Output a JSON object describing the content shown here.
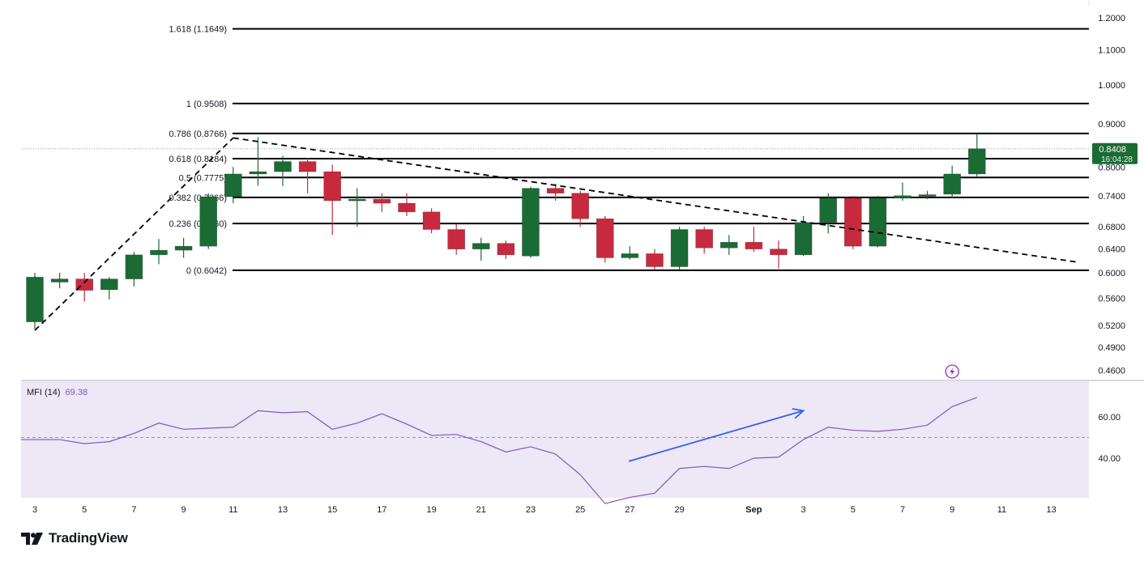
{
  "chart_data": {
    "type": "candlestick",
    "platform": "TradingView",
    "dates": [
      "Aug 3",
      "Aug 4",
      "Aug 5",
      "Aug 6",
      "Aug 7",
      "Aug 8",
      "Aug 9",
      "Aug 10",
      "Aug 11",
      "Aug 12",
      "Aug 13",
      "Aug 14",
      "Aug 15",
      "Aug 16",
      "Aug 17",
      "Aug 18",
      "Aug 19",
      "Aug 20",
      "Aug 21",
      "Aug 22",
      "Aug 23",
      "Aug 24",
      "Aug 25",
      "Aug 26",
      "Aug 27",
      "Aug 28",
      "Aug 29",
      "Aug 30",
      "Aug 31",
      "Sep 1",
      "Sep 2",
      "Sep 3",
      "Sep 4",
      "Sep 5",
      "Sep 6",
      "Sep 7",
      "Sep 8",
      "Sep 9"
    ],
    "ohlc": [
      [
        0.525,
        0.6,
        0.515,
        0.593
      ],
      [
        0.585,
        0.6,
        0.575,
        0.59
      ],
      [
        0.59,
        0.6,
        0.555,
        0.572
      ],
      [
        0.573,
        0.593,
        0.558,
        0.59
      ],
      [
        0.59,
        0.635,
        0.578,
        0.63
      ],
      [
        0.63,
        0.658,
        0.614,
        0.638
      ],
      [
        0.638,
        0.66,
        0.625,
        0.645
      ],
      [
        0.645,
        0.745,
        0.64,
        0.738
      ],
      [
        0.738,
        0.8,
        0.725,
        0.785
      ],
      [
        0.785,
        0.868,
        0.76,
        0.79
      ],
      [
        0.79,
        0.825,
        0.76,
        0.812
      ],
      [
        0.812,
        0.82,
        0.745,
        0.79
      ],
      [
        0.79,
        0.805,
        0.665,
        0.73
      ],
      [
        0.73,
        0.755,
        0.68,
        0.733
      ],
      [
        0.733,
        0.745,
        0.708,
        0.725
      ],
      [
        0.725,
        0.745,
        0.7,
        0.708
      ],
      [
        0.708,
        0.715,
        0.668,
        0.675
      ],
      [
        0.675,
        0.685,
        0.63,
        0.64
      ],
      [
        0.64,
        0.66,
        0.62,
        0.65
      ],
      [
        0.65,
        0.655,
        0.623,
        0.63
      ],
      [
        0.628,
        0.758,
        0.625,
        0.755
      ],
      [
        0.755,
        0.765,
        0.73,
        0.745
      ],
      [
        0.745,
        0.75,
        0.68,
        0.695
      ],
      [
        0.695,
        0.7,
        0.617,
        0.625
      ],
      [
        0.625,
        0.645,
        0.622,
        0.632
      ],
      [
        0.632,
        0.64,
        0.605,
        0.61
      ],
      [
        0.61,
        0.68,
        0.605,
        0.675
      ],
      [
        0.675,
        0.68,
        0.632,
        0.642
      ],
      [
        0.642,
        0.665,
        0.63,
        0.652
      ],
      [
        0.652,
        0.68,
        0.635,
        0.64
      ],
      [
        0.64,
        0.655,
        0.607,
        0.63
      ],
      [
        0.63,
        0.7,
        0.628,
        0.688
      ],
      [
        0.688,
        0.745,
        0.668,
        0.735
      ],
      [
        0.735,
        0.74,
        0.64,
        0.645
      ],
      [
        0.645,
        0.74,
        0.643,
        0.735
      ],
      [
        0.735,
        0.767,
        0.73,
        0.74
      ],
      [
        0.74,
        0.75,
        0.733,
        0.742
      ],
      [
        0.743,
        0.803,
        0.735,
        0.785
      ],
      [
        0.785,
        0.876,
        0.78,
        0.8408
      ]
    ],
    "x_tick_labels": [
      "3",
      "5",
      "7",
      "9",
      "11",
      "13",
      "15",
      "17",
      "19",
      "21",
      "23",
      "25",
      "27",
      "29",
      "Sep",
      "3",
      "5",
      "7",
      "9",
      "11",
      "13"
    ],
    "y_tick_labels": [
      "1.2000",
      "1.1000",
      "1.0000",
      "0.9000",
      "0.8000",
      "0.7400",
      "0.6800",
      "0.6400",
      "0.6000",
      "0.5600",
      "0.5200",
      "0.4900",
      "0.4600"
    ],
    "y_scale": "log",
    "fibonacci_levels": [
      {
        "label": "1.618 (1.1649)",
        "value": 1.1649
      },
      {
        "label": "1 (0.9508)",
        "value": 0.9508
      },
      {
        "label": "0.786 (0.8766)",
        "value": 0.8766
      },
      {
        "label": "0.618 (0.8184)",
        "value": 0.8184
      },
      {
        "label": "0.5 (0.7775)",
        "value": 0.7775
      },
      {
        "label": "0.382 (0.7366)",
        "value": 0.7366
      },
      {
        "label": "0.236 (0.6860)",
        "value": 0.686
      },
      {
        "label": "0 (0.6042)",
        "value": 0.6042
      }
    ],
    "last_price": {
      "price": "0.8408",
      "countdown": "16:04:28",
      "value": 0.8408
    },
    "trendlines": [
      {
        "style": "dashed",
        "from": {
          "date": "Aug 3",
          "value": 0.513
        },
        "to": {
          "date": "Aug 11",
          "value": 0.866
        }
      },
      {
        "style": "dashed",
        "from": {
          "date": "Aug 11",
          "value": 0.866
        },
        "to": {
          "date": "Sep 14",
          "value": 0.618
        }
      }
    ],
    "mfi": {
      "label": "MFI (14)",
      "value_text": "69.38",
      "y_tick_labels": [
        "60.00",
        "40.00"
      ],
      "midline": 50,
      "values": [
        49,
        49,
        47,
        48,
        52,
        57,
        54,
        54.5,
        55,
        63,
        62,
        62.5,
        54,
        57,
        61.5,
        56.5,
        51,
        51.5,
        48,
        43,
        45.5,
        42,
        32,
        18,
        21,
        23,
        35,
        36,
        35,
        40,
        40.5,
        49,
        55,
        53.5,
        53,
        54,
        56,
        65,
        69.38
      ],
      "arrow": {
        "from": {
          "date": "Aug 28",
          "value": 38.5
        },
        "to": {
          "date": "Sep 3",
          "value": 63
        }
      }
    },
    "colors": {
      "up": "#1b6b35",
      "down": "#c72a3e",
      "fib_line": "#000000",
      "mfi_line": "#7e57c2",
      "mfi_background": "#ede7f6",
      "arrow": "#3563e9",
      "price_label_bg": "#1b6b35"
    }
  },
  "brand": {
    "name": "TradingView"
  }
}
